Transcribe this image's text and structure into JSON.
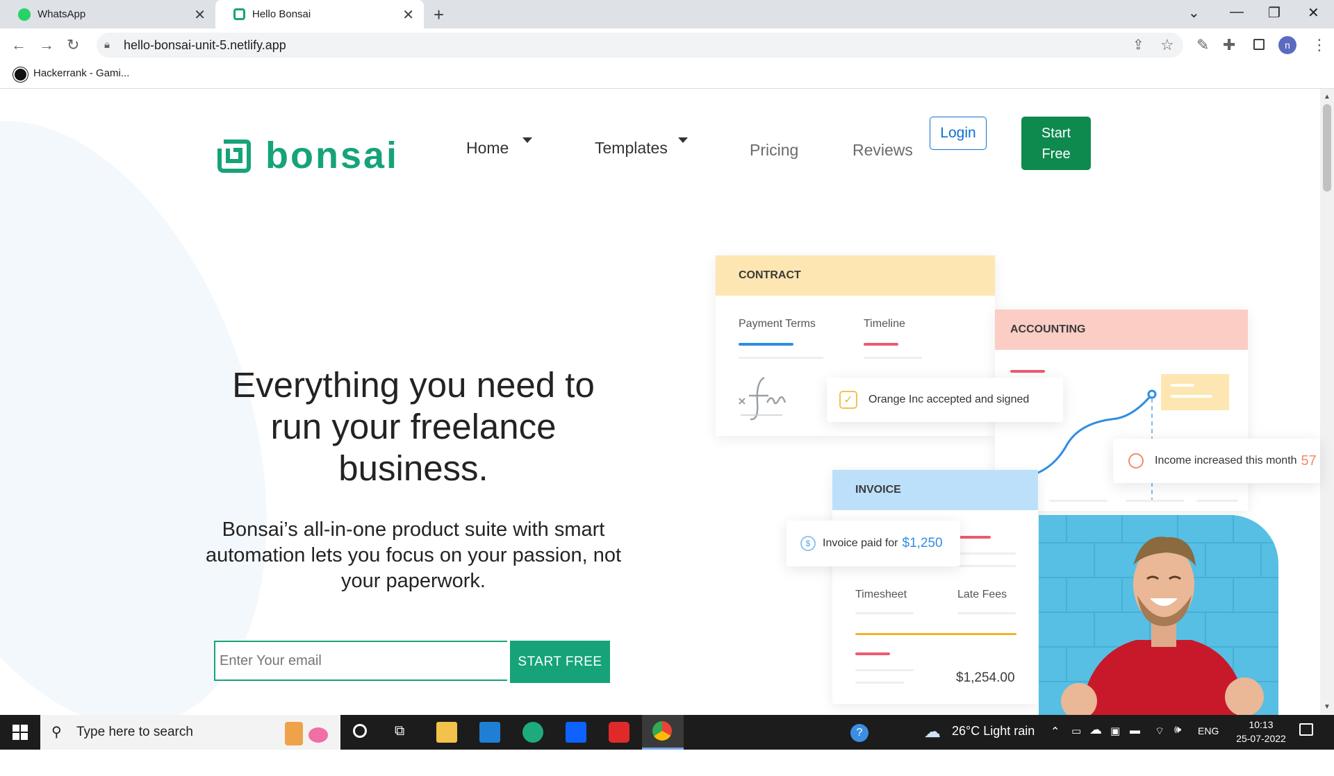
{
  "browser": {
    "tabs": [
      {
        "title": "WhatsApp",
        "active": false
      },
      {
        "title": "Hello Bonsai",
        "active": true
      }
    ],
    "url": "hello-bonsai-unit-5.netlify.app",
    "bookmark": "Hackerrank - Gami...",
    "profile_initial": "n"
  },
  "nav": {
    "logo": "bonsai",
    "links": [
      "Home",
      "Templates",
      "Pricing",
      "Reviews"
    ],
    "login": "Login",
    "start_line1": "Start",
    "start_line2": "Free"
  },
  "hero": {
    "title_line1": "Everything you need to",
    "title_line2": "run your freelance",
    "title_line3": "business.",
    "subtitle_line1": "Bonsai’s all-in-one product suite with smart",
    "subtitle_line2": "automation lets you focus on your passion, not",
    "subtitle_line3": "your paperwork.",
    "email_placeholder": "Enter Your email",
    "cta": "START FREE"
  },
  "illustration": {
    "contract": {
      "header": "CONTRACT",
      "tab1": "Payment Terms",
      "tab2": "Timeline"
    },
    "accounting": {
      "header": "ACCOUNTING"
    },
    "invoice": {
      "header": "INVOICE",
      "col1": "Timesheet",
      "col2": "Late Fees",
      "amount": "$1,254.00"
    },
    "notif_signed": "Orange Inc accepted and signed",
    "notif_income": "Income increased this month",
    "notif_income_value": "57",
    "notif_paid": "Invoice paid for",
    "notif_paid_value": "$1,250"
  },
  "taskbar": {
    "search_placeholder": "Type here to search",
    "weather": "26°C  Light rain",
    "lang": "ENG",
    "time": "10:13",
    "date": "25-07-2022"
  },
  "colors": {
    "brand_green": "#16a37a",
    "start_button": "#0f8a4f",
    "login_blue": "#0f6fd1",
    "contract_head": "#fde6b1",
    "accounting_head": "#fbcdc4",
    "invoice_head": "#bde0fa"
  }
}
